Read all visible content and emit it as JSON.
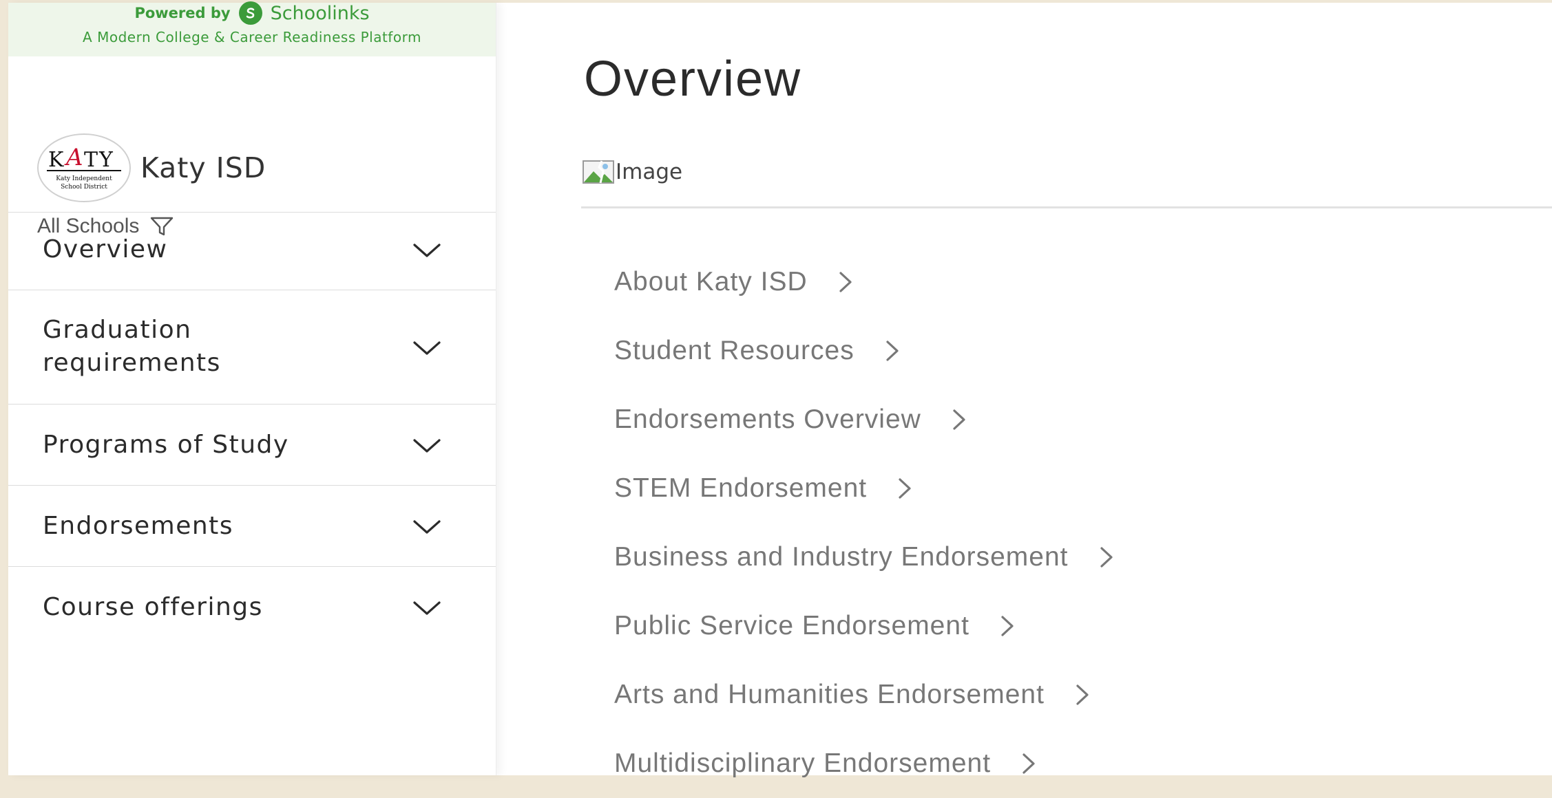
{
  "sidebar": {
    "powered_by": "Powered by",
    "brand": "Schoolinks",
    "tagline": "A Modern College & Career Readiness Platform",
    "district_name": "Katy ISD",
    "school_filter": "All Schools",
    "nav_items": [
      {
        "label": "Overview",
        "icon": "chevron-down-icon"
      },
      {
        "label": "Graduation requirements",
        "icon": "chevron-down-icon"
      },
      {
        "label": "Programs of Study",
        "icon": "chevron-down-icon"
      },
      {
        "label": "Endorsements",
        "icon": "chevron-down-icon"
      },
      {
        "label": "Course offerings",
        "icon": "chevron-down-icon"
      }
    ]
  },
  "main": {
    "title": "Overview",
    "image_alt": "Image",
    "links": [
      {
        "label": "About Katy ISD",
        "icon": "chevron-right-icon"
      },
      {
        "label": "Student Resources",
        "icon": "chevron-right-icon"
      },
      {
        "label": "Endorsements Overview",
        "icon": "chevron-right-icon"
      },
      {
        "label": "STEM Endorsement",
        "icon": "chevron-right-icon"
      },
      {
        "label": "Business and Industry Endorsement",
        "icon": "chevron-right-icon"
      },
      {
        "label": "Public Service Endorsement",
        "icon": "chevron-right-icon"
      },
      {
        "label": "Arts and Humanities Endorsement",
        "icon": "chevron-right-icon"
      },
      {
        "label": "Multidisciplinary Endorsement",
        "icon": "chevron-right-icon"
      }
    ]
  },
  "colors": {
    "brand_green": "#3b9b3a",
    "powered_bg": "#eef6ea",
    "page_bg": "#efe7d6",
    "link_gray": "#777777",
    "text_dark": "#2b2b2b",
    "logo_red": "#c8102e"
  },
  "logo": {
    "wordmark": "KATY",
    "subtitle_line1": "Katy Independent",
    "subtitle_line2": "School District"
  }
}
